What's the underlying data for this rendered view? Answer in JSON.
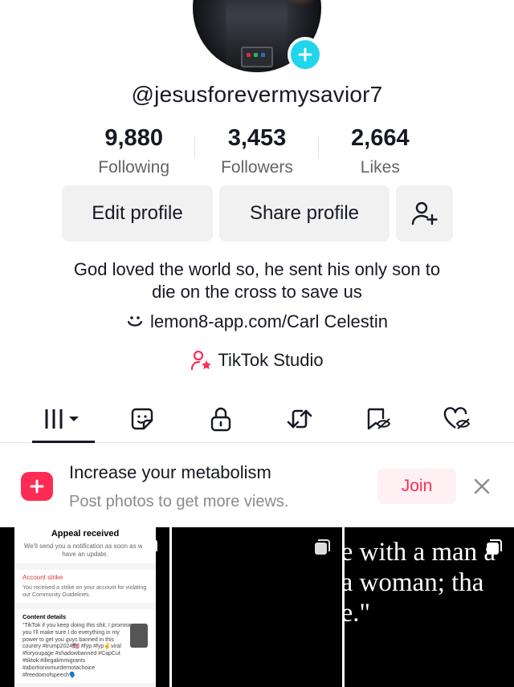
{
  "profile": {
    "username": "@jesusforevermysavior7",
    "stats": [
      {
        "value": "9,880",
        "label": "Following"
      },
      {
        "value": "3,453",
        "label": "Followers"
      },
      {
        "value": "2,664",
        "label": "Likes"
      }
    ],
    "buttons": {
      "edit": "Edit profile",
      "share": "Share profile"
    },
    "bio_line1": "God loved the world so, he sent his only son to",
    "bio_line2": "die on the cross to save us",
    "link": "lemon8-app.com/Carl Celestin",
    "studio": "TikTok Studio"
  },
  "tabs": [
    "videos",
    "reposts-sticker",
    "private",
    "reposts",
    "favorites",
    "liked"
  ],
  "promo": {
    "title": "Increase your metabolism",
    "subtitle": "Post photos to get more views.",
    "action": "Join"
  },
  "grid": {
    "appeal": {
      "title": "Appeal received",
      "notice": "We'll send you a notification as soon as we have an update.",
      "strike_title": "Account strike",
      "strike_desc": "You received a strike on your account for violating our Community Guidelines.",
      "content_title": "Content details",
      "quote": "\"TikTok if you keep doing this shit, I promise you I'll make sure I do everything in my power to get you guys banned in this country #trump2024🇺🇸 #fyp #fyp✌️viral #foryoupage #shadowbanned #CapCut #tiktok #illegalimmigrants #abortionismurdernotachoice #freedomofspeech🗣️"
    },
    "verse_lines": [
      "e with a man a",
      "a woman; tha",
      "e.\""
    ]
  },
  "colors": {
    "accent": "#fe2c55",
    "badge": "#20d5ec",
    "text": "#161823",
    "muted": "#8a8b91"
  }
}
